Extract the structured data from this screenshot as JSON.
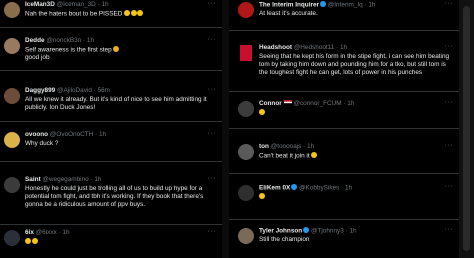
{
  "left_column": {
    "tweets": [
      {
        "name": "IceMan3D",
        "handle": "@Iceman_3D · 1h",
        "text": "Nah the haters bout to be PISSED",
        "emojis": [
          "grin-emoji",
          "grin-emoji",
          "grin-emoji"
        ],
        "avatar_color": "#8a6d4b"
      },
      {
        "name": "Dedde",
        "handle": "@nonckB3n · 1h",
        "text": "Self awareness is the first step",
        "emojis": [
          "flexed-biceps-emoji"
        ],
        "text2": "good job",
        "avatar_color": "#9a7a5e"
      },
      {
        "name": "Daggy899",
        "handle": "@AjiloDavid · 56m",
        "text": "All we knew it already. But it's kind of nice to see him admitting it publicly. Ion Duck Jones!",
        "avatar_color": "#6b4d3a"
      },
      {
        "name": "ovoono",
        "handle": "@OvoOnoCTH · 1h",
        "text": "Why duck ?",
        "avatar_color": "#d9b24a"
      },
      {
        "name": "Saint",
        "handle": "@wegegambino · 1h",
        "text": "Honestly he could just be trolling all of us to build up hype for a potential tom fight, and tbh it's working. If they book that there's gonna be a ridiculous amount of ppv buys.",
        "avatar_color": "#3b3b3b"
      },
      {
        "name": "6ix",
        "handle": "@6ixxx · 1h",
        "text": "",
        "emojis": [
          "grin-emoji",
          "grin-emoji"
        ],
        "avatar_color": "#2a2f3a"
      }
    ]
  },
  "right_column": {
    "tweets": [
      {
        "name": "The Interim Inquirer",
        "handle": "@Interim_Iq · 1h",
        "text": "At least it's accurate.",
        "avatar_color": "#b01818"
      },
      {
        "name": "Headshoot",
        "handle": "@Hedshoot11 · 1h",
        "text": "Seeing that he kept his form in the stipe fight, i can see him beating tom by taking him down and pounding him for a tko, but still tom is the toughest fight he can get, lots of power in his punches",
        "avatar_color": "#c8102e"
      },
      {
        "name": "Connor",
        "handle": "@connor_FCUM · 1h",
        "text": "",
        "emojis": [
          "grin-emoji"
        ],
        "avatar_color": "#3c3c3c"
      },
      {
        "name": "ton",
        "handle": "@tooooajs · 1h",
        "text": "Can't beat it join it",
        "emojis": [
          "grin-emoji"
        ],
        "avatar_color": "#5a5a5a"
      },
      {
        "name": "EliKem 0X",
        "handle": "@KobbySikes · 1h",
        "text": "",
        "emojis": [
          "grin-emoji"
        ],
        "avatar_color": "#2f2f2f"
      },
      {
        "name": "Tyler Johnson",
        "handle": "@Tjohnny3 · 1h",
        "text": "Still the champion",
        "avatar_color": "#7a6a58"
      }
    ]
  },
  "more_label": "···",
  "colors": {
    "background": "#000000",
    "text": "#e7e9ea",
    "secondary": "#71767b",
    "divider": "#2f3336",
    "verified": "#1d9bf0"
  }
}
